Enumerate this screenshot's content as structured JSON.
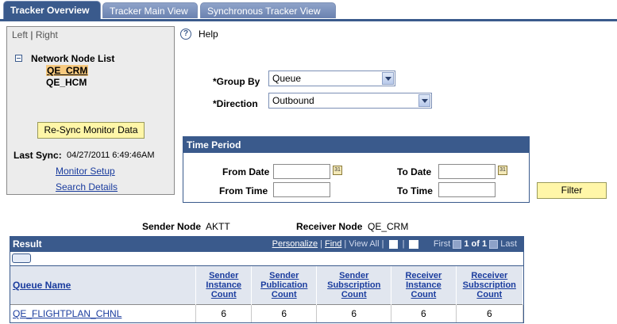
{
  "tabs": [
    {
      "label": "Tracker Overview",
      "active": true
    },
    {
      "label": "Tracker Main View",
      "active": false
    },
    {
      "label": "Synchronous Tracker View",
      "active": false
    }
  ],
  "left_panel": {
    "left_label": "Left",
    "right_label": "Right",
    "node_list_title": "Network Node List",
    "nodes": [
      "QE_CRM",
      "QE_HCM"
    ],
    "resync_button": "Re-Sync Monitor Data",
    "last_sync_label": "Last Sync:",
    "last_sync_value": "04/27/2011  6:49:46AM",
    "monitor_setup_link": "Monitor Setup",
    "search_details_link": "Search Details"
  },
  "help": {
    "label": "Help"
  },
  "group_by": {
    "label": "*Group By",
    "value": "Queue"
  },
  "direction": {
    "label": "*Direction",
    "value": "Outbound"
  },
  "time_period": {
    "title": "Time Period",
    "from_date_label": "From Date",
    "to_date_label": "To Date",
    "from_time_label": "From Time",
    "to_time_label": "To Time",
    "calendar_glyph": "31"
  },
  "filter_button": "Filter",
  "node_info": {
    "sender_label": "Sender Node",
    "sender_value": "AKTT",
    "receiver_label": "Receiver Node",
    "receiver_value": "QE_CRM"
  },
  "result": {
    "title": "Result",
    "personalize": "Personalize",
    "find": "Find",
    "view_all": "View All",
    "first": "First",
    "range": "1 of 1",
    "last": "Last",
    "columns": [
      "Queue Name",
      "Sender Instance Count",
      "Sender Publication Count",
      "Sender Subscription Count",
      "Receiver Instance Count",
      "Receiver Subscription Count"
    ],
    "rows": [
      {
        "queue": "QE_FLIGHTPLAN_CHNL",
        "c1": "6",
        "c2": "6",
        "c3": "6",
        "c4": "6",
        "c5": "6"
      }
    ]
  },
  "colors": {
    "header_blue": "#3a5a8c",
    "button_yellow": "#fff6a8",
    "link_blue": "#1a3c9e"
  }
}
